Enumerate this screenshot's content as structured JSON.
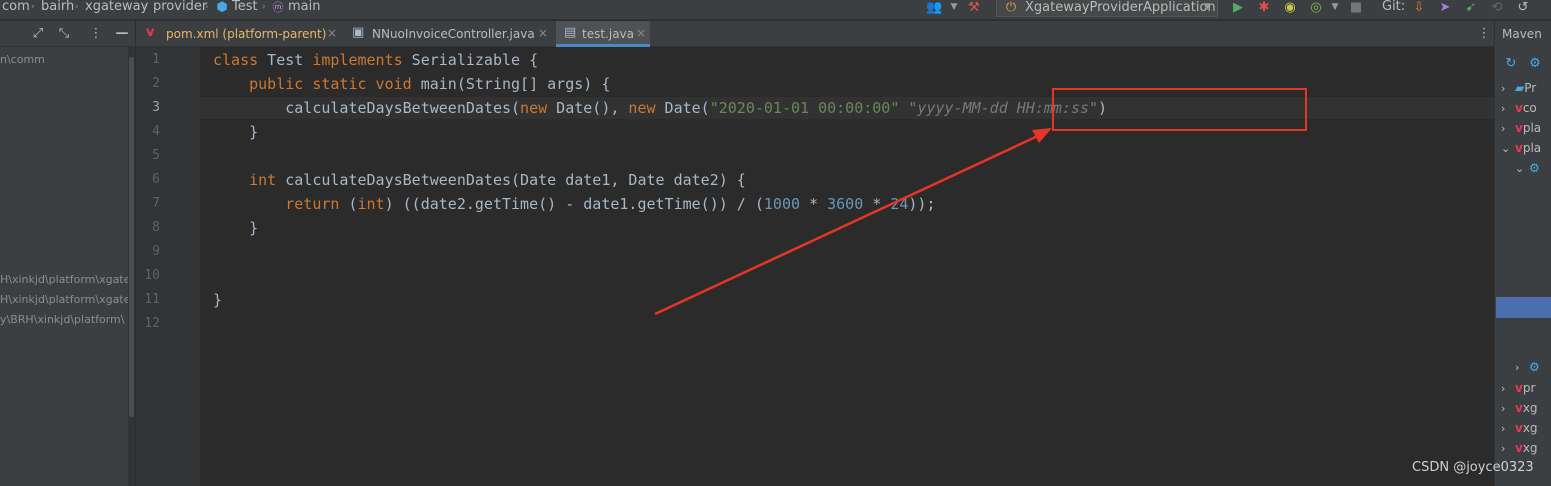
{
  "breadcrumb": {
    "items": [
      "com",
      "bairh",
      "xgateway",
      "provider",
      "Test",
      "main"
    ]
  },
  "toolbar": {
    "run_config_label": "XgatewayProviderApplication",
    "git_label": "Git:"
  },
  "tabs": [
    {
      "label": "pom.xml (platform-parent)",
      "icon": "maven-icon"
    },
    {
      "label": "NNuoInvoiceController.java",
      "icon": "java-class-icon"
    },
    {
      "label": "test.java",
      "icon": "java-file-icon",
      "active": true
    }
  ],
  "left_panel": {
    "paths": [
      "n\\comm",
      "H\\xinkjd\\platform\\xgate",
      "H\\xinkjd\\platform\\xgate",
      "y\\BRH\\xinkjd\\platform\\"
    ]
  },
  "editor": {
    "line_numbers": [
      "1",
      "2",
      "3",
      "4",
      "5",
      "6",
      "7",
      "8",
      "9",
      "10",
      "11",
      "12"
    ],
    "current_line": "3",
    "code": {
      "l1_kw1": "class",
      "l1_name": " Test ",
      "l1_kw2": "implements",
      "l1_rest": " Serializable {",
      "l2_indent": "    ",
      "l2_kw": "public static void",
      "l2_rest": " main(String[] args) {",
      "l3_pre": "        calculateDaysBetweenDates(",
      "l3_new1": "new",
      "l3_mid": " Date(), ",
      "l3_new2": "new",
      "l3_date": " Date(",
      "l3_str": "\"2020-01-01 00:00:00\"",
      "l3_hint": " \"yyyy-MM-dd HH:mm:ss\"",
      "l3_close": ")",
      "l4": "    }",
      "l6_indent": "    ",
      "l6_kw": "int",
      "l6_rest": " calculateDaysBetweenDates(Date date1, Date date2) {",
      "l7_indent": "        ",
      "l7_kw": "return",
      "l7_a": " (",
      "l7_int": "int",
      "l7_b": ") ((date2.getTime() - date1.getTime()) / (",
      "l7_n1": "1000",
      "l7_c": " * ",
      "l7_n2": "3600",
      "l7_d": " * ",
      "l7_n3": "24",
      "l7_e": "));",
      "l8": "    }",
      "l11": "}"
    }
  },
  "maven": {
    "title": "Maven",
    "rows": [
      {
        "arrow": "›",
        "label": "Pr"
      },
      {
        "arrow": "›",
        "label": "co"
      },
      {
        "arrow": "›",
        "label": "pla"
      },
      {
        "arrow": "⌄",
        "label": "pla"
      },
      {
        "arrow": "⌄",
        "label": ""
      },
      {
        "arrow": "›",
        "label": ""
      },
      {
        "arrow": "›",
        "label": "pr"
      },
      {
        "arrow": "›",
        "label": "xg"
      },
      {
        "arrow": "›",
        "label": "xg"
      },
      {
        "arrow": "›",
        "label": "xg"
      }
    ]
  },
  "watermark": "CSDN @joyce0323",
  "colors": {
    "annotation": "#e53527",
    "keyword": "#cc7832",
    "string": "#6a8759",
    "number": "#6897bb"
  }
}
